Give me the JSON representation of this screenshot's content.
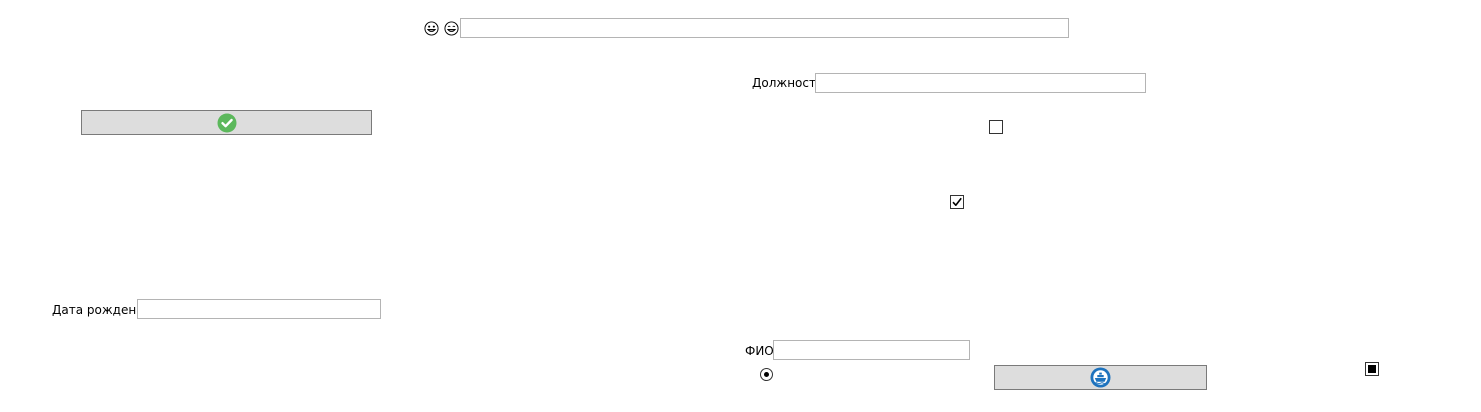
{
  "top_bar": {
    "icons": [
      "emoji-grin-icon",
      "emoji-smile-icon"
    ],
    "text_value": ""
  },
  "position_field": {
    "label": "Должность",
    "value": ""
  },
  "birthdate_field": {
    "label": "Дата рождения",
    "value": ""
  },
  "name_field": {
    "label": "ФИО",
    "value": ""
  },
  "confirm_button": {
    "icon": "checkmark-circle-icon",
    "icon_color": "#5cb85c"
  },
  "ship_button": {
    "icon": "ship-circle-icon",
    "icon_color": "#1e73be"
  },
  "checkboxes": {
    "unchecked": false,
    "checked": true
  },
  "radio": {
    "selected": true
  },
  "toggle_square": {
    "state": "indeterminate"
  }
}
